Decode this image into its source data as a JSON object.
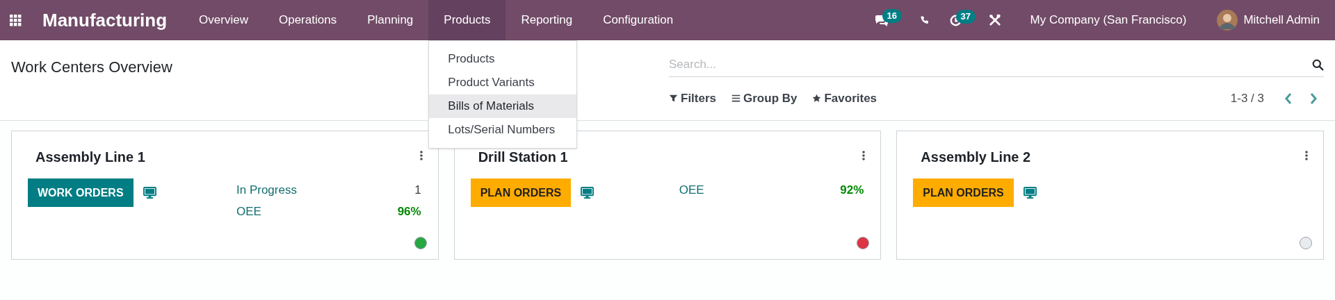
{
  "navbar": {
    "app_name": "Manufacturing",
    "menus": [
      {
        "label": "Overview",
        "selected": false
      },
      {
        "label": "Operations",
        "selected": false
      },
      {
        "label": "Planning",
        "selected": false
      },
      {
        "label": "Products",
        "selected": true
      },
      {
        "label": "Reporting",
        "selected": false
      },
      {
        "label": "Configuration",
        "selected": false
      }
    ],
    "dropdown": [
      {
        "label": "Products",
        "selected": false
      },
      {
        "label": "Product Variants",
        "selected": false
      },
      {
        "label": "Bills of Materials",
        "selected": true
      },
      {
        "label": "Lots/Serial Numbers",
        "selected": false
      }
    ],
    "messages_badge": "16",
    "activities_badge": "37",
    "company": "My Company (San Francisco)",
    "user": "Mitchell Admin"
  },
  "control_panel": {
    "title": "Work Centers Overview",
    "search": {
      "placeholder": "Search..."
    },
    "filters": [
      {
        "kind": "filter",
        "label": "Filters"
      },
      {
        "kind": "group",
        "label": "Group By"
      },
      {
        "kind": "favorite",
        "label": "Favorites"
      }
    ],
    "pager": "1-3 / 3"
  },
  "cards": [
    {
      "title": "Assembly Line 1",
      "button": {
        "label": "WORK ORDERS",
        "kind": "primary"
      },
      "stats": [
        {
          "label": "In Progress",
          "value": "1",
          "kind": "count"
        },
        {
          "label": "OEE",
          "value": "96%",
          "kind": "good"
        }
      ],
      "color": "#28a745"
    },
    {
      "title": "Drill Station 1",
      "button": {
        "label": "PLAN ORDERS",
        "kind": "warning"
      },
      "stats": [
        {
          "label": "OEE",
          "value": "92%",
          "kind": "good"
        }
      ],
      "color": "#dc3545"
    },
    {
      "title": "Assembly Line 2",
      "button": {
        "label": "PLAN ORDERS",
        "kind": "warning"
      },
      "color": "#e9ecef"
    }
  ]
}
